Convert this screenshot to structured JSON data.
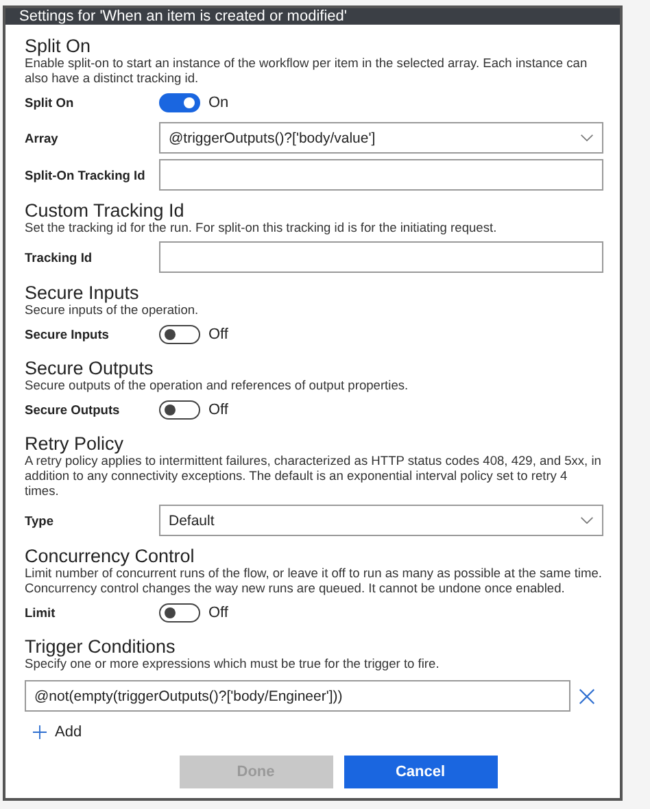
{
  "window": {
    "title": "Settings for 'When an item is created or modified'"
  },
  "sections": [
    {
      "title": "Split On",
      "description": "Enable split-on to start an instance of the workflow per item in the selected array. Each instance can also have a distinct tracking id.",
      "rows": [
        {
          "kind": "toggle",
          "label": "Split On",
          "on": true,
          "state_text": "On"
        },
        {
          "kind": "select",
          "label": "Array",
          "value": "@triggerOutputs()?['body/value']"
        },
        {
          "kind": "text",
          "label": "Split-On Tracking Id"
        }
      ]
    },
    {
      "title": "Custom Tracking Id",
      "description": "Set the tracking id for the run. For split-on this tracking id is for the initiating request.",
      "rows": [
        {
          "kind": "text",
          "label": "Tracking Id"
        }
      ]
    },
    {
      "title": "Secure Inputs",
      "description": "Secure inputs of the operation.",
      "rows": [
        {
          "kind": "toggle",
          "label": "Secure Inputs",
          "on": false,
          "state_text": "Off"
        }
      ]
    },
    {
      "title": "Secure Outputs",
      "description": "Secure outputs of the operation and references of output properties.",
      "rows": [
        {
          "kind": "toggle",
          "label": "Secure Outputs",
          "on": false,
          "state_text": "Off"
        }
      ]
    },
    {
      "title": "Retry Policy",
      "description": "A retry policy applies to intermittent failures, characterized as HTTP status codes 408, 429, and 5xx, in addition to any connectivity exceptions. The default is an exponential interval policy set to retry 4 times.",
      "rows": [
        {
          "kind": "select",
          "label": "Type",
          "value": "Default"
        }
      ]
    },
    {
      "title": "Concurrency Control",
      "description": "Limit number of concurrent runs of the flow, or leave it off to run as many as possible at the same time. Concurrency control changes the way new runs are queued. It cannot be undone once enabled.",
      "rows": [
        {
          "kind": "toggle",
          "label": "Limit",
          "on": false,
          "state_text": "Off"
        }
      ]
    },
    {
      "title": "Trigger Conditions",
      "description": "Specify one or more expressions which must be true for the trigger to fire.",
      "rows": [
        {
          "kind": "conditions",
          "values": [
            "@not(empty(triggerOutputs()?['body/Engineer']))"
          ],
          "add_label": "Add"
        }
      ]
    }
  ],
  "buttons": [
    {
      "label": "Done",
      "disabled": true,
      "primary": false
    },
    {
      "label": "Cancel",
      "disabled": false,
      "primary": true
    }
  ]
}
